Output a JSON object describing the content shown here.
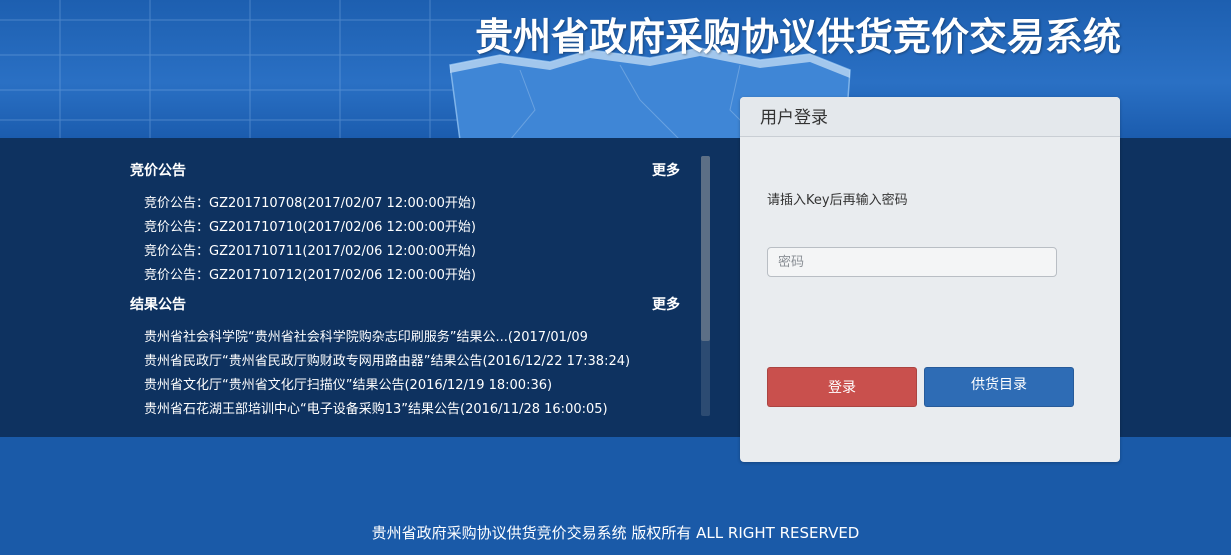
{
  "header": {
    "title": "贵州省政府采购协议供货竞价交易系统"
  },
  "news": {
    "bidding": {
      "title": "竞价公告",
      "more": "更多",
      "items": [
        "竞价公告：GZ201710708(2017/02/07 12:00:00开始)",
        "竞价公告：GZ201710710(2017/02/06 12:00:00开始)",
        "竞价公告：GZ201710711(2017/02/06 12:00:00开始)",
        "竞价公告：GZ201710712(2017/02/06 12:00:00开始)"
      ]
    },
    "results": {
      "title": "结果公告",
      "more": "更多",
      "items": [
        "贵州省社会科学院“贵州省社会科学院购杂志印刷服务”结果公...(2017/01/09",
        "贵州省民政厅“贵州省民政厅购财政专网用路由器”结果公告(2016/12/22 17:38:24)",
        "贵州省文化厅“贵州省文化厅扫描仪”结果公告(2016/12/19 18:00:36)",
        "贵州省石花湖王部培训中心“电子设备采购13”结果公告(2016/11/28 16:00:05)"
      ]
    }
  },
  "login": {
    "title": "用户登录",
    "hint": "请插入Key后再输入密码",
    "password_placeholder": "密码",
    "login_label": "登录",
    "catalog_label": "供货目录"
  },
  "footer": {
    "text": "贵州省政府采购协议供货竞价交易系统 版权所有 ALL RIGHT RESERVED"
  },
  "colors": {
    "background": "#1a5aa8",
    "band": "#0e3260",
    "login_button": "#c9504d",
    "catalog_button": "#2e6cb5"
  }
}
